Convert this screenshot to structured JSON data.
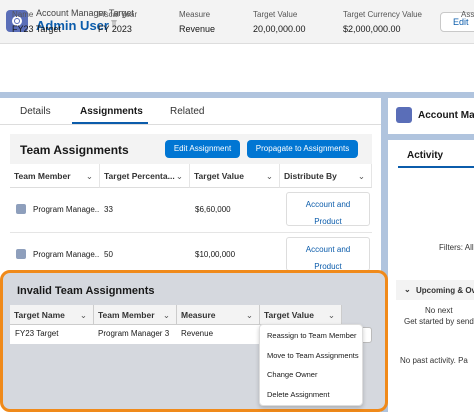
{
  "header": {
    "object_type": "Account Manager Target",
    "title": "Admin User",
    "edit_label": "Edit"
  },
  "highlights": [
    {
      "label": "Name",
      "value": "FY23 Target"
    },
    {
      "label": "Fiscal Year",
      "value": "FY 2023"
    },
    {
      "label": "Measure",
      "value": "Revenue"
    },
    {
      "label": "Target Value",
      "value": "20,00,000.00"
    },
    {
      "label": "Target Currency Value",
      "value": "$2,000,000.00"
    },
    {
      "label": "Ass",
      "value": ""
    }
  ],
  "tabs": [
    "Details",
    "Assignments",
    "Related"
  ],
  "team_assignments": {
    "title": "Team Assignments",
    "edit_button": "Edit Assignment",
    "propagate_button": "Propagate to Assignments",
    "columns": [
      "Team Member",
      "Target Percenta...",
      "Target Value",
      "Distribute By"
    ],
    "rows": [
      {
        "member": "Program Manage...",
        "percent": "33",
        "value": "$6,60,000",
        "distribute_line1": "Account and",
        "distribute_line2": "Product"
      },
      {
        "member": "Program Manage...",
        "percent": "50",
        "value": "$10,00,000",
        "distribute_line1": "Account and",
        "distribute_line2": "Product"
      }
    ]
  },
  "invalid_assignments": {
    "title": "Invalid Team Assignments",
    "columns": [
      "Target Name",
      "Team Member",
      "Measure",
      "Target Value"
    ],
    "row": {
      "target_name": "FY23 Target",
      "member": "Program Manager 3",
      "measure": "Revenue"
    }
  },
  "row_menu": [
    "Reassign to Team Member",
    "Move to Team Assignments",
    "Change Owner",
    "Delete Assignment"
  ],
  "right_panel": {
    "title": "Account Man",
    "activity_tab": "Activity",
    "filters": "Filters: All",
    "upcoming": "Upcoming & Ov",
    "no_next": "No next",
    "get_started": "Get started by send",
    "no_past": "No past activity. Pa"
  },
  "colors": {
    "accent": "#0176d3",
    "highlight_border": "#f08a1a",
    "link": "#0b5cab"
  }
}
